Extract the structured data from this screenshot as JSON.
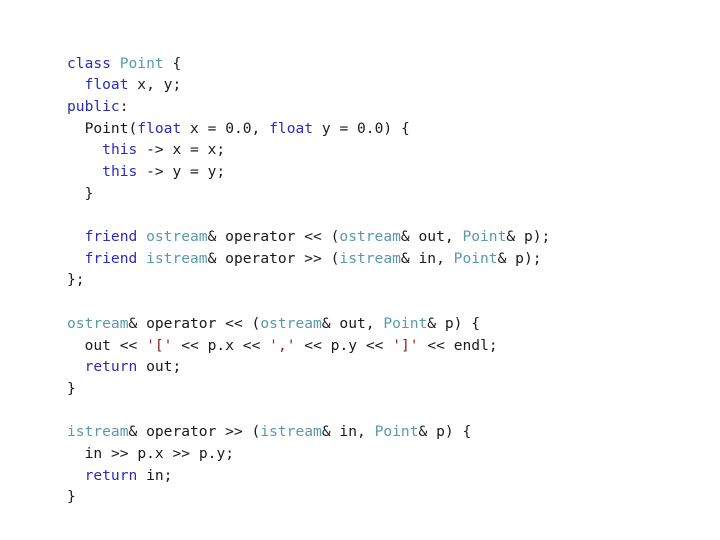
{
  "slide": {
    "background_color": "#ffffff",
    "language": "cpp",
    "title_visible": false
  },
  "colors": {
    "keyword": "#2b2bbf",
    "type": "#5a9aa8",
    "variable": "#8c8c8c",
    "char_literal": "#8f2020",
    "plain": "#1a1a1a",
    "background": "#ffffff"
  },
  "code": {
    "plain_text": "class Point {\n  float x, y;\npublic:\n  Point(float x = 0.0, float y = 0.0) {\n    this -> x = x;\n    this -> y = y;\n  }\n\n  friend ostream& operator << (ostream& out, Point& p);\n  friend istream& operator >> (istream& in, Point& p);\n};\n\nostream& operator << (ostream& out, Point& p) {\n  out << '[' << p.x << ',' << p.y << ']' << endl;\n  return out;\n}\n\nistream& operator >> (istream& in, Point& p) {\n  in >> p.x >> p.y;\n  return in;\n}",
    "lines": [
      {
        "n": 1,
        "text": "class Point {",
        "tokens": [
          {
            "t": "class",
            "c": "keyword"
          },
          {
            "t": " ",
            "c": "plain"
          },
          {
            "t": "Point",
            "c": "type"
          },
          {
            "t": " {",
            "c": "plain"
          }
        ]
      },
      {
        "n": 2,
        "text": "  float x, y;",
        "tokens": [
          {
            "t": "  ",
            "c": "plain"
          },
          {
            "t": "float",
            "c": "keyword"
          },
          {
            "t": " x, y;",
            "c": "plain"
          }
        ]
      },
      {
        "n": 3,
        "text": "public:",
        "tokens": [
          {
            "t": "public",
            "c": "keyword"
          },
          {
            "t": ":",
            "c": "plain"
          }
        ]
      },
      {
        "n": 4,
        "text": "  Point(float x = 0.0, float y = 0.0) {",
        "tokens": [
          {
            "t": "  Point(",
            "c": "plain"
          },
          {
            "t": "float",
            "c": "keyword"
          },
          {
            "t": " ",
            "c": "plain"
          },
          {
            "t": "x",
            "c": "variable"
          },
          {
            "t": " = ",
            "c": "plain"
          },
          {
            "t": "0.0",
            "c": "plain"
          },
          {
            "t": ", ",
            "c": "plain"
          },
          {
            "t": "float",
            "c": "keyword"
          },
          {
            "t": " ",
            "c": "plain"
          },
          {
            "t": "y",
            "c": "variable"
          },
          {
            "t": " = ",
            "c": "plain"
          },
          {
            "t": "0.0",
            "c": "plain"
          },
          {
            "t": ") {",
            "c": "plain"
          }
        ]
      },
      {
        "n": 5,
        "text": "    this -> x = x;",
        "tokens": [
          {
            "t": "    ",
            "c": "plain"
          },
          {
            "t": "this",
            "c": "keyword"
          },
          {
            "t": " -> x = ",
            "c": "plain"
          },
          {
            "t": "x",
            "c": "variable"
          },
          {
            "t": ";",
            "c": "plain"
          }
        ]
      },
      {
        "n": 6,
        "text": "    this -> y = y;",
        "tokens": [
          {
            "t": "    ",
            "c": "plain"
          },
          {
            "t": "this",
            "c": "keyword"
          },
          {
            "t": " -> y = ",
            "c": "plain"
          },
          {
            "t": "y",
            "c": "variable"
          },
          {
            "t": ";",
            "c": "plain"
          }
        ]
      },
      {
        "n": 7,
        "text": "  }",
        "tokens": [
          {
            "t": "  }",
            "c": "plain"
          }
        ]
      },
      {
        "n": 8,
        "text": "",
        "tokens": []
      },
      {
        "n": 9,
        "text": "  friend ostream& operator << (ostream& out, Point& p);",
        "tokens": [
          {
            "t": "  ",
            "c": "plain"
          },
          {
            "t": "friend",
            "c": "keyword"
          },
          {
            "t": " ",
            "c": "plain"
          },
          {
            "t": "ostream",
            "c": "type"
          },
          {
            "t": "& operator << (",
            "c": "plain"
          },
          {
            "t": "ostream",
            "c": "type"
          },
          {
            "t": "& ",
            "c": "plain"
          },
          {
            "t": "out",
            "c": "plain"
          },
          {
            "t": ", ",
            "c": "plain"
          },
          {
            "t": "Point",
            "c": "type"
          },
          {
            "t": "& p);",
            "c": "plain"
          }
        ]
      },
      {
        "n": 10,
        "text": "  friend istream& operator >> (istream& in, Point& p);",
        "tokens": [
          {
            "t": "  ",
            "c": "plain"
          },
          {
            "t": "friend",
            "c": "keyword"
          },
          {
            "t": " ",
            "c": "plain"
          },
          {
            "t": "istream",
            "c": "type"
          },
          {
            "t": "& operator >> (",
            "c": "plain"
          },
          {
            "t": "istream",
            "c": "type"
          },
          {
            "t": "& ",
            "c": "plain"
          },
          {
            "t": "in",
            "c": "plain"
          },
          {
            "t": ", ",
            "c": "plain"
          },
          {
            "t": "Point",
            "c": "type"
          },
          {
            "t": "& p);",
            "c": "plain"
          }
        ]
      },
      {
        "n": 11,
        "text": "};",
        "tokens": [
          {
            "t": "};",
            "c": "plain"
          }
        ]
      },
      {
        "n": 12,
        "text": "",
        "tokens": []
      },
      {
        "n": 13,
        "text": "ostream& operator << (ostream& out, Point& p) {",
        "tokens": [
          {
            "t": "ostream",
            "c": "type"
          },
          {
            "t": "& operator << (",
            "c": "plain"
          },
          {
            "t": "ostream",
            "c": "type"
          },
          {
            "t": "& ",
            "c": "plain"
          },
          {
            "t": "out",
            "c": "variable"
          },
          {
            "t": ", ",
            "c": "plain"
          },
          {
            "t": "Point",
            "c": "type"
          },
          {
            "t": "& ",
            "c": "plain"
          },
          {
            "t": "p",
            "c": "variable"
          },
          {
            "t": ") {",
            "c": "plain"
          }
        ]
      },
      {
        "n": 14,
        "text": "  out << '[' << p.x << ',' << p.y << ']' << endl;",
        "tokens": [
          {
            "t": "  ",
            "c": "plain"
          },
          {
            "t": "out",
            "c": "variable"
          },
          {
            "t": " << ",
            "c": "plain"
          },
          {
            "t": "'['",
            "c": "char_literal"
          },
          {
            "t": " << ",
            "c": "plain"
          },
          {
            "t": "p",
            "c": "variable"
          },
          {
            "t": ".",
            "c": "plain"
          },
          {
            "t": "x",
            "c": "variable"
          },
          {
            "t": " << ",
            "c": "plain"
          },
          {
            "t": "','",
            "c": "char_literal"
          },
          {
            "t": " << ",
            "c": "plain"
          },
          {
            "t": "p",
            "c": "variable"
          },
          {
            "t": ".",
            "c": "plain"
          },
          {
            "t": "y",
            "c": "variable"
          },
          {
            "t": " << ",
            "c": "plain"
          },
          {
            "t": "']'",
            "c": "char_literal"
          },
          {
            "t": " << endl;",
            "c": "plain"
          }
        ]
      },
      {
        "n": 15,
        "text": "  return out;",
        "tokens": [
          {
            "t": "  ",
            "c": "plain"
          },
          {
            "t": "return",
            "c": "keyword"
          },
          {
            "t": " ",
            "c": "plain"
          },
          {
            "t": "out",
            "c": "variable"
          },
          {
            "t": ";",
            "c": "plain"
          }
        ]
      },
      {
        "n": 16,
        "text": "}",
        "tokens": [
          {
            "t": "}",
            "c": "plain"
          }
        ]
      },
      {
        "n": 17,
        "text": "",
        "tokens": []
      },
      {
        "n": 18,
        "text": "istream& operator >> (istream& in, Point& p) {",
        "tokens": [
          {
            "t": "istream",
            "c": "type"
          },
          {
            "t": "& operator >> (",
            "c": "plain"
          },
          {
            "t": "istream",
            "c": "type"
          },
          {
            "t": "& ",
            "c": "plain"
          },
          {
            "t": "in",
            "c": "variable"
          },
          {
            "t": ", ",
            "c": "plain"
          },
          {
            "t": "Point",
            "c": "type"
          },
          {
            "t": "& ",
            "c": "plain"
          },
          {
            "t": "p",
            "c": "variable"
          },
          {
            "t": ") {",
            "c": "plain"
          }
        ]
      },
      {
        "n": 19,
        "text": "  in >> p.x >> p.y;",
        "tokens": [
          {
            "t": "  ",
            "c": "plain"
          },
          {
            "t": "in",
            "c": "variable"
          },
          {
            "t": " >> ",
            "c": "plain"
          },
          {
            "t": "p",
            "c": "variable"
          },
          {
            "t": ".",
            "c": "plain"
          },
          {
            "t": "x",
            "c": "variable"
          },
          {
            "t": " >> ",
            "c": "plain"
          },
          {
            "t": "p",
            "c": "variable"
          },
          {
            "t": ".",
            "c": "plain"
          },
          {
            "t": "y",
            "c": "variable"
          },
          {
            "t": ";",
            "c": "plain"
          }
        ]
      },
      {
        "n": 20,
        "text": "  return in;",
        "tokens": [
          {
            "t": "  ",
            "c": "plain"
          },
          {
            "t": "return",
            "c": "keyword"
          },
          {
            "t": " ",
            "c": "plain"
          },
          {
            "t": "in",
            "c": "variable"
          },
          {
            "t": ";",
            "c": "plain"
          }
        ]
      },
      {
        "n": 21,
        "text": "}",
        "tokens": [
          {
            "t": "}",
            "c": "plain"
          }
        ]
      }
    ]
  }
}
